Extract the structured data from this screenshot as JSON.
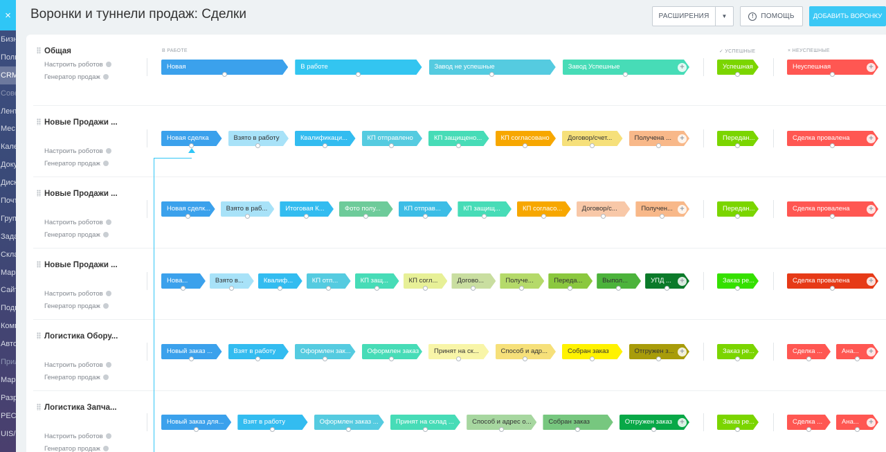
{
  "header": {
    "title": "Воронки и туннели продаж: Сделки",
    "extensions_label": "РАСШИРЕНИЯ",
    "help_label": "ПОМОЩЬ",
    "add_label": "ДОБАВИТЬ ВОРОНКУ"
  },
  "sidebar": {
    "close_icon": "×",
    "items": [
      "Бизн",
      "Поль",
      "CRM",
      "Сове",
      "Лент",
      "Мес",
      "Кале",
      "Доку",
      "Диск",
      "Почт",
      "Груп",
      "Зада",
      "Скла",
      "Мар",
      "Сайт",
      "Подп",
      "Комп",
      "Авто",
      "Прил",
      "Мар",
      "Разр",
      "РЕСТ",
      "UIS/"
    ]
  },
  "columns": {
    "in_work": "В РАБОТЕ",
    "success": "УСПЕШНЫЕ",
    "fail": "НЕУСПЕШНЫЕ",
    "success_icon": "✓",
    "fail_icon": "×"
  },
  "links": {
    "robots": "Настроить роботов",
    "generator": "Генератор продаж"
  },
  "funnels": [
    {
      "name": "Общая",
      "stages": [
        {
          "label": "Новая",
          "color": "#3ba1ec"
        },
        {
          "label": "В работе",
          "color": "#33c5f0"
        },
        {
          "label": "Завод не успешные",
          "color": "#55cbe0"
        },
        {
          "label": "Завод Успешные",
          "color": "#47dcb7"
        }
      ],
      "success": [
        {
          "label": "Успешная",
          "color": "#7bd500"
        }
      ],
      "fail": [
        {
          "label": "Неуспешная",
          "color": "#ff5752"
        }
      ]
    },
    {
      "name": "Новые Продажи ...",
      "stages": [
        {
          "label": "Новая сделка",
          "color": "#3ba1ec"
        },
        {
          "label": "Взято в работу",
          "color": "#a8e2f8",
          "dark": true
        },
        {
          "label": "Квалификаци...",
          "color": "#33bcf0"
        },
        {
          "label": "КП отправлено",
          "color": "#55cbe0"
        },
        {
          "label": "КП защищено...",
          "color": "#47dcb7"
        },
        {
          "label": "КП согласовано",
          "color": "#f7a700"
        },
        {
          "label": "Договор/счет...",
          "color": "#f6e07a",
          "dark": true
        },
        {
          "label": "Получена ...",
          "color": "#f8b889",
          "dark": true
        }
      ],
      "success": [
        {
          "label": "Передан...",
          "color": "#7bd500"
        }
      ],
      "fail": [
        {
          "label": "Сделка провалена",
          "color": "#ff5752"
        }
      ]
    },
    {
      "name": "Новые Продажи ...",
      "stages": [
        {
          "label": "Новая сделк...",
          "color": "#3ba1ec"
        },
        {
          "label": "Взято в раб...",
          "color": "#a8e2f8",
          "dark": true
        },
        {
          "label": "Итоговая К...",
          "color": "#33bcf0"
        },
        {
          "label": "Фото полу...",
          "color": "#6ecb9a"
        },
        {
          "label": "КП отправ...",
          "color": "#3cbde6"
        },
        {
          "label": "КП защищ...",
          "color": "#47dcb7"
        },
        {
          "label": "КП согласо...",
          "color": "#f7a700"
        },
        {
          "label": "Договор/с...",
          "color": "#f8c8a8",
          "dark": true
        },
        {
          "label": "Получен...",
          "color": "#f8b889",
          "dark": true
        }
      ],
      "success": [
        {
          "label": "Передан...",
          "color": "#7bd500"
        }
      ],
      "fail": [
        {
          "label": "Сделка провалена",
          "color": "#ff5752"
        }
      ]
    },
    {
      "name": "Новые Продажи ...",
      "stages": [
        {
          "label": "Нова...",
          "color": "#3ba1ec"
        },
        {
          "label": "Взято в...",
          "color": "#a8e2f8",
          "dark": true
        },
        {
          "label": "Квалиф...",
          "color": "#33bcf0"
        },
        {
          "label": "КП отп...",
          "color": "#55cbe0"
        },
        {
          "label": "КП защ...",
          "color": "#47dcb7"
        },
        {
          "label": "КП согл...",
          "color": "#e7f097",
          "dark": true
        },
        {
          "label": "Догово...",
          "color": "#c9dea0",
          "dark": true
        },
        {
          "label": "Получе...",
          "color": "#b5da6a",
          "dark": true
        },
        {
          "label": "Переда...",
          "color": "#8bc83f",
          "dark": true
        },
        {
          "label": "Выпол...",
          "color": "#4cb33b",
          "dark": true
        },
        {
          "label": "УПД ...",
          "color": "#0b7a2a"
        }
      ],
      "success": [
        {
          "label": "Заказ ре...",
          "color": "#35e000"
        }
      ],
      "fail": [
        {
          "label": "Сделка провалена",
          "color": "#e63a17"
        }
      ]
    },
    {
      "name": "Логистика Обору...",
      "stages": [
        {
          "label": "Новый заказ ...",
          "color": "#3ba1ec"
        },
        {
          "label": "Взят в работу",
          "color": "#33bcf0"
        },
        {
          "label": "Оформлен зак...",
          "color": "#55cbe0"
        },
        {
          "label": "Оформлен заказ",
          "color": "#47dcb7"
        },
        {
          "label": "Принят на ск...",
          "color": "#f8f5a8",
          "dark": true
        },
        {
          "label": "Способ и адр...",
          "color": "#f6e07a",
          "dark": true
        },
        {
          "label": "Собран заказ",
          "color": "#fff200",
          "dark": true
        },
        {
          "label": "Отгружен з...",
          "color": "#a89c0a",
          "dark": true
        }
      ],
      "success": [
        {
          "label": "Заказ ре...",
          "color": "#7bd500"
        }
      ],
      "fail": [
        {
          "label": "Сделка ...",
          "color": "#ff5752"
        },
        {
          "label": "Ана...",
          "color": "#ff5752"
        }
      ]
    },
    {
      "name": "Логистика Запча...",
      "stages": [
        {
          "label": "Новый заказ для...",
          "color": "#3ba1ec"
        },
        {
          "label": "Взят в работу",
          "color": "#33bcf0"
        },
        {
          "label": "Оформлен заказ ...",
          "color": "#55cbe0"
        },
        {
          "label": "Принят на склад ...",
          "color": "#47dcb7"
        },
        {
          "label": "Способ и адрес о...",
          "color": "#a7d7a0",
          "dark": true
        },
        {
          "label": "Собран заказ",
          "color": "#77c77f",
          "dark": true
        },
        {
          "label": "Отгружен заказ",
          "color": "#08a847"
        }
      ],
      "success": [
        {
          "label": "Заказ ре...",
          "color": "#7bd500"
        }
      ],
      "fail": [
        {
          "label": "Сделка ...",
          "color": "#ff5752"
        },
        {
          "label": "Ана...",
          "color": "#ff5752"
        }
      ]
    }
  ]
}
